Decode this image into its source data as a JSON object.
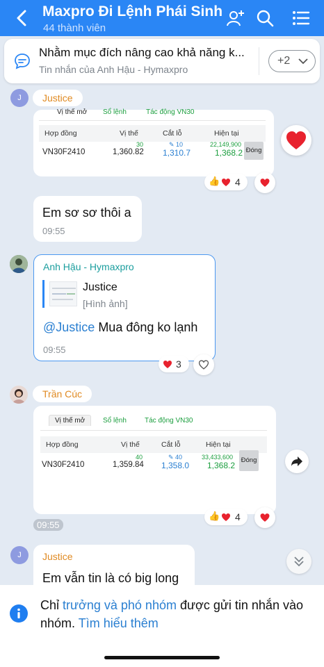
{
  "header": {
    "title": "Maxpro Đi Lệnh Phái Sinh",
    "member_count": "44 thành viên"
  },
  "pinned": {
    "text": "Nhằm mục đích nâng cao khả năng k...",
    "sub": "Tin nhắn của Anh Hậu - Hymaxpro",
    "more": "+2"
  },
  "messages": [
    {
      "sender_initial": "J",
      "sender": "Justice",
      "table": {
        "tabs": [
          "Vị thế mở",
          "Sổ lệnh",
          "Tác động VN30"
        ],
        "headers": [
          "Hợp đồng",
          "Vị thế",
          "Cắt lỗ",
          "Hiện tại"
        ],
        "contract": "VN30F2410",
        "qty": "30",
        "price": "1,360.82",
        "stop_qty": "10",
        "stop_price": "1,310.7",
        "pnl": "22,149,900",
        "current": "1,368.2",
        "action": "Đóng"
      },
      "reaction_count": "4"
    },
    {
      "text": "Em sơ sơ thôi a",
      "time": "09:55"
    },
    {
      "sender": "Anh Hậu - Hymaxpro",
      "quote_name": "Justice",
      "quote_type": "[Hình ảnh]",
      "mention": "@Justice",
      "text": "Mua đông ko lạnh",
      "time": "09:55",
      "reaction_count": "3"
    },
    {
      "sender": "Trần Cúc",
      "table": {
        "tabs": [
          "Vị thế mở",
          "Sổ lệnh",
          "Tác động VN30"
        ],
        "headers": [
          "Hợp đồng",
          "Vị thế",
          "Cắt lỗ",
          "Hiện tại"
        ],
        "contract": "VN30F2410",
        "qty": "40",
        "price": "1,359.84",
        "stop_qty": "40",
        "stop_price": "1,358.0",
        "pnl": "33,433,600",
        "current": "1,368.2",
        "action": "Đóng"
      },
      "time": "09:55",
      "reaction_count": "4"
    },
    {
      "sender_initial": "J",
      "sender": "Justice",
      "text": "Em vẫn tin là có big long"
    }
  ],
  "footer": {
    "t1": "Chỉ ",
    "link1": "trưởng và phó nhóm",
    "t2": " được gửi tin nhắn vào nhóm. ",
    "link2": "Tìm hiểu thêm"
  },
  "colors": {
    "header": "#2a86f5",
    "background": "#e3eaf3",
    "sender_name": "#e08a22",
    "link": "#2a7fd1",
    "positive": "#1b9e3e"
  }
}
